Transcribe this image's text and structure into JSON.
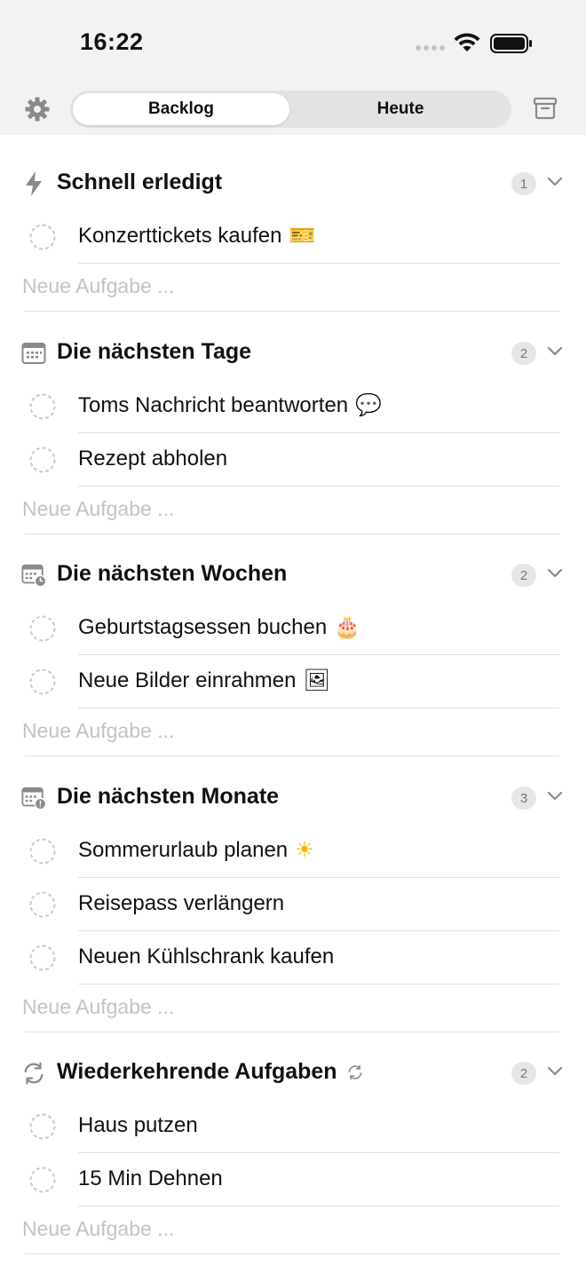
{
  "status_bar": {
    "time": "16:22"
  },
  "header": {
    "tabs": [
      {
        "label": "Backlog",
        "active": true
      },
      {
        "label": "Heute",
        "active": false
      }
    ]
  },
  "new_task_placeholder": "Neue Aufgabe ...",
  "sections": [
    {
      "title": "Schnell erledigt",
      "icon": "bolt-icon",
      "count": "1",
      "tasks": [
        {
          "label": "Konzerttickets kaufen",
          "emoji": "🎫"
        }
      ]
    },
    {
      "title": "Die nächsten Tage",
      "icon": "calendar-icon",
      "count": "2",
      "tasks": [
        {
          "label": "Toms Nachricht beantworten",
          "emoji": "💬"
        },
        {
          "label": "Rezept abholen",
          "emoji": ""
        }
      ]
    },
    {
      "title": "Die nächsten Wochen",
      "icon": "calendar-clock-icon",
      "count": "2",
      "tasks": [
        {
          "label": "Geburtstagsessen buchen",
          "emoji": "🎂"
        },
        {
          "label": "Neue Bilder einrahmen",
          "emoji": "🖼"
        }
      ]
    },
    {
      "title": "Die nächsten Monate",
      "icon": "calendar-alert-icon",
      "count": "3",
      "tasks": [
        {
          "label": "Sommerurlaub planen",
          "emoji": "☀"
        },
        {
          "label": "Reisepass verlängern",
          "emoji": ""
        },
        {
          "label": "Neuen Kühlschrank kaufen",
          "emoji": ""
        }
      ]
    },
    {
      "title": "Wiederkehrende Aufgaben",
      "icon": "repeat-icon",
      "count": "2",
      "tasks": [
        {
          "label": "Haus putzen",
          "emoji": ""
        },
        {
          "label": "15 Min Dehnen",
          "emoji": ""
        }
      ]
    }
  ],
  "colors": {
    "header_bg": "#f2f2f2",
    "segment_bg": "#e3e3e3",
    "badge_bg": "#e6e6e6",
    "placeholder": "#c3c3c3",
    "divider": "#dedede"
  }
}
